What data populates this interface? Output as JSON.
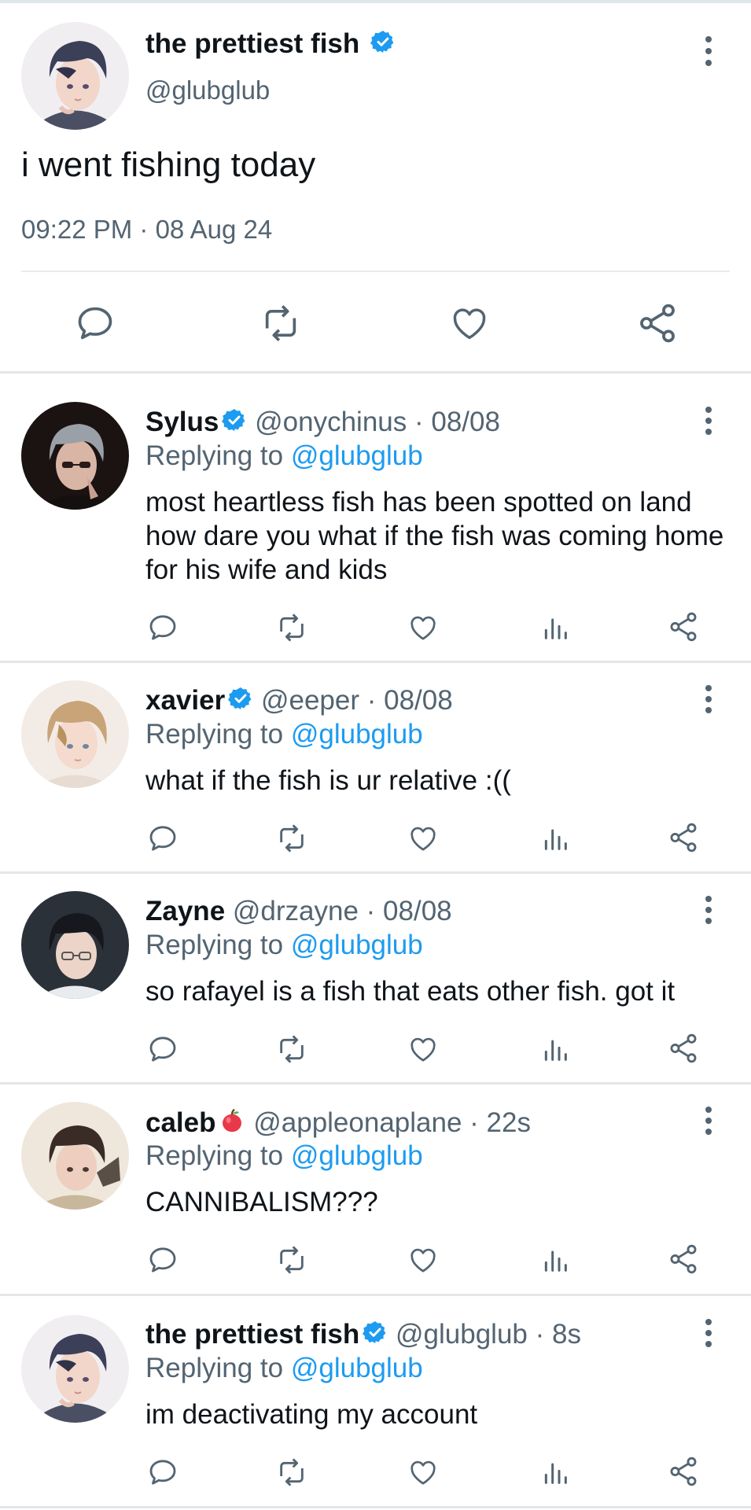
{
  "main_tweet": {
    "display_name": "the prettiest fish",
    "handle": "@glubglub",
    "text": "i went fishing today",
    "timestamp": "09:22 PM · 08 Aug 24",
    "verified": true
  },
  "replies": [
    {
      "display_name": "Sylus",
      "verified": true,
      "handle": "@onychinus",
      "time": "· 08/08",
      "replying_prefix": "Replying to ",
      "replying_to": "@glubglub",
      "text": "most heartless fish has been spotted on land how dare you what if the fish was coming home for his wife and kids"
    },
    {
      "display_name": "xavier",
      "verified": true,
      "handle": "@eeper",
      "time": "· 08/08",
      "replying_prefix": "Replying to ",
      "replying_to": "@glubglub",
      "text": "what if the fish is ur relative :(("
    },
    {
      "display_name": "Zayne",
      "verified": false,
      "handle": "@drzayne",
      "time": "· 08/08",
      "replying_prefix": "Replying to ",
      "replying_to": "@glubglub",
      "text": "so rafayel is a fish that eats other fish. got it"
    },
    {
      "display_name": "caleb",
      "verified": false,
      "emoji": "apple-emoji",
      "handle": "@appleonaplane",
      "time": "· 22s",
      "replying_prefix": "Replying to ",
      "replying_to": "@glubglub",
      "text": "CANNIBALISM???"
    },
    {
      "display_name": "the prettiest fish",
      "verified": true,
      "handle": "@glubglub",
      "time": "· 8s",
      "replying_prefix": "Replying to ",
      "replying_to": "@glubglub",
      "text": "im deactivating my account"
    }
  ],
  "icons": {
    "reply": "reply-icon",
    "retweet": "retweet-icon",
    "like": "like-icon",
    "analytics": "analytics-icon",
    "share": "share-icon",
    "more": "more-icon",
    "verified": "verified-badge-icon"
  },
  "colors": {
    "accent": "#1d9bf0",
    "text": "#0f1419",
    "muted": "#536471",
    "icon": "#536471",
    "divider": "#e7ebee"
  }
}
